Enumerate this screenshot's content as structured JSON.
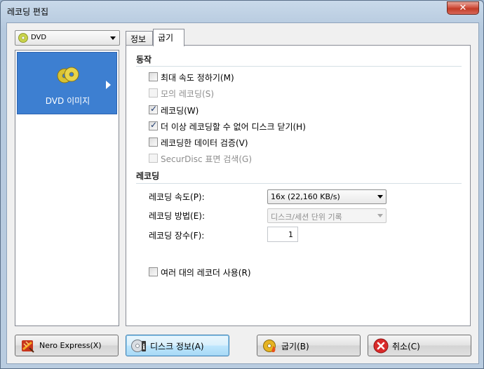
{
  "window": {
    "title": "레코딩 편집",
    "close_symbol": "✕"
  },
  "device_selector": {
    "value": "DVD"
  },
  "left_panel": {
    "selected_item": "DVD 이미지"
  },
  "tabs": [
    {
      "label": "정보"
    },
    {
      "label": "굽기"
    }
  ],
  "sections": {
    "action": {
      "title": "동작",
      "options": [
        {
          "label": "최대 속도 정하기(M)",
          "checked": false,
          "enabled": true
        },
        {
          "label": "모의 레코딩(S)",
          "checked": false,
          "enabled": false
        },
        {
          "label": "레코딩(W)",
          "checked": true,
          "enabled": true
        },
        {
          "label": "더 이상 레코딩할 수 없어 디스크 닫기(H)",
          "checked": true,
          "enabled": true
        },
        {
          "label": "레코딩한 데이터 검증(V)",
          "checked": false,
          "enabled": true
        },
        {
          "label": "SecurDisc 표면 검색(G)",
          "checked": false,
          "enabled": false
        }
      ]
    },
    "recording": {
      "title": "레코딩",
      "speed_label": "레코딩 속도(P):",
      "speed_value": "16x (22,160 KB/s)",
      "method_label": "레코딩 방법(E):",
      "method_value": "디스크/세션 단위 기록",
      "copies_label": "레코딩 장수(F):",
      "copies_value": "1",
      "multi_recorder": {
        "label": "여러 대의 레코더 사용(R)",
        "checked": false
      }
    }
  },
  "buttons": {
    "nero_express": "Nero Express(X)",
    "disc_info": "디스크 정보(A)",
    "burn": "굽기(B)",
    "cancel": "취소(C)"
  },
  "colors": {
    "tile_bg": "#3d7fd1",
    "cancel_red": "#d92a2a",
    "burn_gold": "#e6b422"
  }
}
